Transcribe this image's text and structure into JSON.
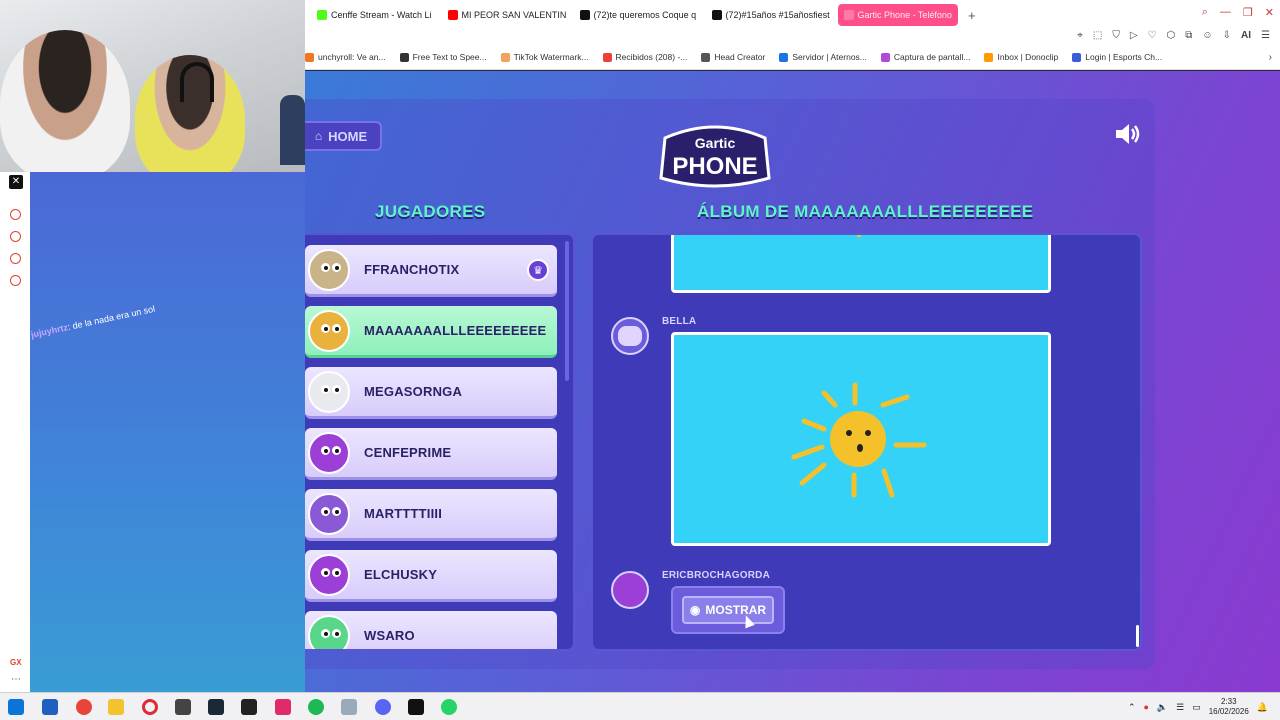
{
  "browser": {
    "tabs": [
      {
        "label": "Cenffe Stream - Watch Li",
        "color": "#53fc18"
      },
      {
        "label": "MI PEOR SAN VALENTIN",
        "color": "#ff0000"
      },
      {
        "label": "(72)te queremos Coque q",
        "color": "#111111"
      },
      {
        "label": "(72)#15años #15añosfiest",
        "color": "#111111"
      },
      {
        "label": "Gartic Phone - Teléfono",
        "color": "#ff7aa8",
        "active": true
      }
    ],
    "new_tab": "+",
    "bookmarks": [
      {
        "label": "unchyroll: Ve an...",
        "color": "#f47521"
      },
      {
        "label": "Free Text to Spee...",
        "color": "#333333"
      },
      {
        "label": "TikTok Watermark...",
        "color": "#f4a259"
      },
      {
        "label": "Recibidos (208) -...",
        "color": "#ea4335"
      },
      {
        "label": "Head Creator",
        "color": "#555555"
      },
      {
        "label": "Servidor | Aternos...",
        "color": "#1a73e8"
      },
      {
        "label": "Captura de pantall...",
        "color": "#b04ad8"
      },
      {
        "label": "Inbox | Donoclip",
        "color": "#ff9a00"
      },
      {
        "label": "Login | Esports Ch...",
        "color": "#3b5bdb"
      }
    ]
  },
  "chat": {
    "user": "jujuyhrtz",
    "message": ": de la nada era un sol"
  },
  "game": {
    "home_label": "HOME",
    "logo_top": "Gartic",
    "logo_bottom": "PHONE",
    "players_title": "JUGADORES",
    "album_title": "ÁLBUM DE MAAAAAAALLLEEEEEEEEE",
    "players": [
      {
        "name": "FFRANCHOTIX",
        "avatar_color": "#c9b48a",
        "host": true
      },
      {
        "name": "MAAAAAAALLLEEEEEEEEE",
        "avatar_color": "#e8b23c",
        "highlight": true
      },
      {
        "name": "MEGASORNGA",
        "avatar_color": "#e9e9f0"
      },
      {
        "name": "CENFEPRIME",
        "avatar_color": "#9b3fd6"
      },
      {
        "name": "MARTTTTIIII",
        "avatar_color": "#8a5ad6"
      },
      {
        "name": "ELCHUSKY",
        "avatar_color": "#9b3fd6"
      },
      {
        "name": "WSARO",
        "avatar_color": "#5ad68a"
      }
    ],
    "album_entries": [
      {
        "author": "BELLA"
      },
      {
        "author": "ERICBROCHAGORDA"
      }
    ],
    "reveal_label": "MOSTRAR"
  },
  "taskbar": {
    "time": "2:33",
    "date": "16/02/2026"
  },
  "colors": {
    "accent_title": "#5ef6c8",
    "drawing_bg": "#34d2f6",
    "sun": "#f5c12a"
  }
}
